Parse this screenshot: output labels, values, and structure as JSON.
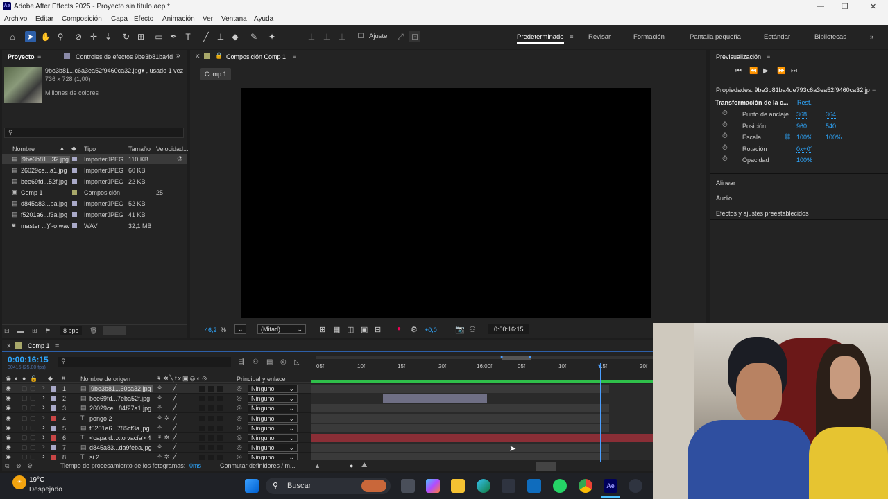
{
  "app": {
    "title": "Adobe After Effects 2025 - Proyecto sin título.aep *",
    "logo_text": "Ae"
  },
  "menu": [
    "Archivo",
    "Editar",
    "Composición",
    "Capa",
    "Efecto",
    "Animación",
    "Ver",
    "Ventana",
    "Ayuda"
  ],
  "toolbar": {
    "snap_label": "Ajuste",
    "workspaces": [
      "Predeterminado",
      "Revisar",
      "Formación",
      "Pantalla pequeña",
      "Estándar",
      "Bibliotecas"
    ]
  },
  "project": {
    "tab_label": "Proyecto",
    "effects_tab": "Controles de efectos 9be3b81ba4d",
    "preview_name": "9be3b81...c6a3ea52f9460ca32.jpg▾ , usado 1 vez",
    "preview_dims": "736 x 728 (1,00)",
    "preview_colors": "Millones de colores",
    "columns": [
      "Nombre",
      "Tipo",
      "Tamaño",
      "Velocidad..."
    ],
    "items": [
      {
        "name": "9be3b81...32.jpg",
        "type": "ImporterJPEG",
        "size": "110 KB",
        "speed": "",
        "color": "#a9a9c8"
      },
      {
        "name": "26029ce...a1.jpg",
        "type": "ImporterJPEG",
        "size": "60 KB",
        "speed": "",
        "color": "#a9a9c8"
      },
      {
        "name": "bee69fd...52f.jpg",
        "type": "ImporterJPEG",
        "size": "22 KB",
        "speed": "",
        "color": "#a9a9c8"
      },
      {
        "name": "Comp 1",
        "type": "Composición",
        "size": "",
        "speed": "25",
        "color": "#a8a86a"
      },
      {
        "name": "d845a83...ba.jpg",
        "type": "ImporterJPEG",
        "size": "52 KB",
        "speed": "",
        "color": "#a9a9c8"
      },
      {
        "name": "f5201a6...f3a.jpg",
        "type": "ImporterJPEG",
        "size": "41 KB",
        "speed": "",
        "color": "#a9a9c8"
      },
      {
        "name": "master ...)°-o.wav",
        "type": "WAV",
        "size": "32,1 MB",
        "speed": "",
        "color": "#a9a9c8"
      }
    ],
    "bpc": "8 bpc"
  },
  "composition": {
    "tab_label": "Composición Comp 1",
    "subtab": "Comp 1",
    "zoom": "46,2",
    "zoom_unit": "%",
    "resolution": "(Mitad)",
    "exposure": "+0,0",
    "timecode": "0:00:16:15"
  },
  "preview_panel": {
    "title": "Previsualización"
  },
  "properties": {
    "title": "Propiedades: 9be3b81ba4de793c6a3ea52f9460ca32.jp",
    "section": "Transformación de la c...",
    "reset": "Rest.",
    "rows": [
      {
        "label": "Punto de anclaje",
        "v1": "368",
        "v2": "364"
      },
      {
        "label": "Posición",
        "v1": "960",
        "v2": "540"
      },
      {
        "label": "Escala",
        "v1": "100%",
        "v2": "100%"
      },
      {
        "label": "Rotación",
        "v1": "0x+0°",
        "v2": ""
      },
      {
        "label": "Opacidad",
        "v1": "100%",
        "v2": ""
      }
    ],
    "sections": [
      "Alinear",
      "Audio",
      "Efectos y ajustes preestablecidos"
    ]
  },
  "timeline": {
    "tab_label": "Comp 1",
    "timecode": "0:00:16:15",
    "frames": "00415 (25.00 fps)",
    "col_source": "Nombre de origen",
    "col_parent": "Principal y enlace",
    "ruler": [
      "05f",
      "10f",
      "15f",
      "20f",
      "16:00f",
      "05f",
      "10f",
      "15f",
      "20f"
    ],
    "layers": [
      {
        "num": "1",
        "name": "9be3b81...60ca32.jpg",
        "type": "img",
        "color": "#a9a9c8",
        "parent": "Ninguno"
      },
      {
        "num": "2",
        "name": "bee69fd...7eba52f.jpg",
        "type": "img",
        "color": "#a9a9c8",
        "parent": "Ninguno"
      },
      {
        "num": "3",
        "name": "26029ce...84f27a1.jpg",
        "type": "img",
        "color": "#a9a9c8",
        "parent": "Ninguno"
      },
      {
        "num": "4",
        "name": "pongo 2",
        "type": "text",
        "color": "#c84646",
        "parent": "Ninguno"
      },
      {
        "num": "5",
        "name": "f5201a6...785cf3a.jpg",
        "type": "img",
        "color": "#a9a9c8",
        "parent": "Ninguno"
      },
      {
        "num": "6",
        "name": "<capa d...xto vacía> 4",
        "type": "text",
        "color": "#c84646",
        "parent": "Ninguno"
      },
      {
        "num": "7",
        "name": "d845a83...da9feba.jpg",
        "type": "img",
        "color": "#a9a9c8",
        "parent": "Ninguno"
      },
      {
        "num": "8",
        "name": "si 2",
        "type": "text",
        "color": "#c84646",
        "parent": "Ninguno"
      }
    ],
    "status_label": "Tiempo de procesamiento de los fotogramas:",
    "status_value": "0ms",
    "toggle_label": "Conmutar definidores / m..."
  },
  "taskbar": {
    "temp": "19°C",
    "weather": "Despejado",
    "search": "Buscar"
  }
}
